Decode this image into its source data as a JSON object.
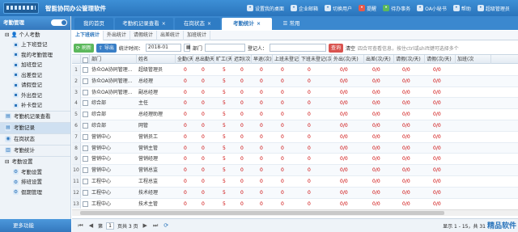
{
  "header": {
    "app_title": "智能协同办公管理软件",
    "nav": [
      {
        "label": "设置我的桌面",
        "icon": "desktop-icon"
      },
      {
        "label": "企业邮箱",
        "icon": "mail-icon"
      },
      {
        "label": "切换用户",
        "icon": "switch-user-icon"
      },
      {
        "label": "提醒",
        "icon": "bell-icon"
      },
      {
        "label": "待办事务",
        "icon": "todo-icon"
      },
      {
        "label": "OA小秘书",
        "icon": "assistant-icon"
      },
      {
        "label": "帮助",
        "icon": "help-icon"
      },
      {
        "label": "超级管理员",
        "icon": "admin-icon"
      }
    ]
  },
  "tabs": [
    {
      "label": "我的首页"
    },
    {
      "label": "考勤机记录查看"
    },
    {
      "label": "在岗状态"
    },
    {
      "label": "考勤统计"
    },
    {
      "label": "常用"
    }
  ],
  "sidebar": {
    "title": "考勤管理",
    "group": "个人考勤",
    "items": [
      "上下班登记",
      "我的考勤管理",
      "加班登记",
      "出差登记",
      "请假登记",
      "外出登记",
      "补卡登记"
    ],
    "sections": [
      "考勤机记录查看",
      "考勤记录",
      "在岗状态",
      "考勤统计",
      "考勤设置"
    ],
    "settings_items": [
      "考勤设置",
      "排班设置",
      "假期管理"
    ],
    "more": "更多功能"
  },
  "subtabs": [
    "上下班统计",
    "外出统计",
    "请假统计",
    "出差统计",
    "加班统计"
  ],
  "toolbar": {
    "refresh": "刷新",
    "export": "导出",
    "time_label": "统计时间：",
    "time_value": "2018-01",
    "dept_label": "部门",
    "registrant_label": "登记人：",
    "query": "查询",
    "clear": "清空",
    "hint": "四合可查看信息，按住ctrl或shift键可选择多个"
  },
  "table": {
    "columns": [
      "部门",
      "姓名",
      "全勤(天)",
      "总出勤天数",
      "旷工(天)",
      "迟到(次)",
      "早退(次)",
      "上班未登记(次)",
      "下班未登记(次)",
      "外出(次/天)",
      "出差(次/天)",
      "请假(次/天)",
      "请假(次/天)",
      "加班(次"
    ],
    "rows": [
      {
        "n": "1",
        "dept": "协众OA协同管理...",
        "name": "超级管理员",
        "v": [
          "0",
          "0",
          "5",
          "0",
          "0",
          "0",
          "0",
          "0/0",
          "0/0",
          "0/0",
          "0/0"
        ]
      },
      {
        "n": "2",
        "dept": "协众OA协同管理...",
        "name": "总经理",
        "v": [
          "0",
          "0",
          "5",
          "0",
          "0",
          "0",
          "0",
          "0/0",
          "0/0",
          "0/0",
          "0/0"
        ]
      },
      {
        "n": "3",
        "dept": "协众OA协同管理...",
        "name": "副总经理",
        "v": [
          "0",
          "0",
          "5",
          "0",
          "0",
          "0",
          "0",
          "0/0",
          "0/0",
          "0/0",
          "0/0"
        ]
      },
      {
        "n": "4",
        "dept": "综合部",
        "name": "主任",
        "v": [
          "0",
          "0",
          "5",
          "0",
          "0",
          "0",
          "0",
          "0/0",
          "0/0",
          "0/0",
          "0/0"
        ]
      },
      {
        "n": "5",
        "dept": "综合部",
        "name": "总经理助理",
        "v": [
          "0",
          "0",
          "5",
          "0",
          "0",
          "0",
          "0",
          "0/0",
          "0/0",
          "0/0",
          "0/0"
        ]
      },
      {
        "n": "6",
        "dept": "综合部",
        "name": "网管",
        "v": [
          "0",
          "0",
          "5",
          "0",
          "0",
          "0",
          "0",
          "0/0",
          "0/0",
          "0/0",
          "0/0"
        ]
      },
      {
        "n": "7",
        "dept": "营销中心",
        "name": "营销员工",
        "v": [
          "0",
          "0",
          "5",
          "0",
          "0",
          "0",
          "0",
          "0/0",
          "0/0",
          "0/0",
          "0/0"
        ]
      },
      {
        "n": "8",
        "dept": "营销中心",
        "name": "营销主管",
        "v": [
          "0",
          "0",
          "5",
          "0",
          "0",
          "0",
          "0",
          "0/0",
          "0/0",
          "0/0",
          "0/0"
        ]
      },
      {
        "n": "9",
        "dept": "营销中心",
        "name": "营销经理",
        "v": [
          "0",
          "0",
          "5",
          "0",
          "0",
          "0",
          "0",
          "0/0",
          "0/0",
          "0/0",
          "0/0"
        ]
      },
      {
        "n": "10",
        "dept": "营销中心",
        "name": "营销总监",
        "v": [
          "0",
          "0",
          "5",
          "0",
          "0",
          "0",
          "0",
          "0/0",
          "0/0",
          "0/0",
          "0/0"
        ]
      },
      {
        "n": "11",
        "dept": "工程中心",
        "name": "工程总监",
        "v": [
          "0",
          "0",
          "5",
          "0",
          "0",
          "0",
          "0",
          "0/0",
          "0/0",
          "0/0",
          "0/0"
        ]
      },
      {
        "n": "12",
        "dept": "工程中心",
        "name": "技术经理",
        "v": [
          "0",
          "0",
          "5",
          "0",
          "0",
          "0",
          "0",
          "0/0",
          "0/0",
          "0/0",
          "0/0"
        ]
      },
      {
        "n": "13",
        "dept": "工程中心",
        "name": "技术主管",
        "v": [
          "0",
          "0",
          "5",
          "0",
          "0",
          "0",
          "0",
          "0/0",
          "0/0",
          "0/0",
          "0/0"
        ]
      }
    ]
  },
  "pager": {
    "page_prefix": "第",
    "page_value": "1",
    "page_suffix": "页共 3 页",
    "summary": "显示 1 - 15，共 31",
    "watermark": "精品软件"
  }
}
